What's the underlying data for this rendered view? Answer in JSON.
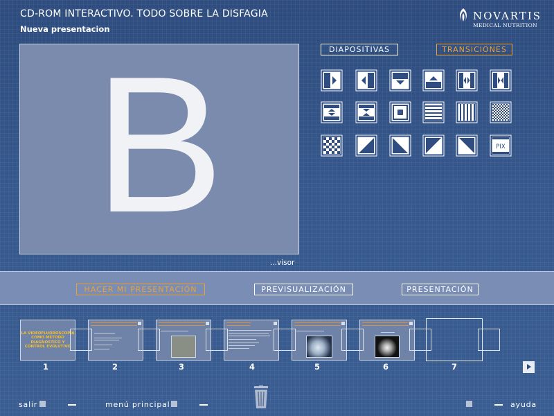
{
  "header": {
    "app_title": "CD-ROM INTERACTIVO. TODO SOBRE LA DISFAGIA",
    "subtitle": "Nueva presentacion",
    "logo": {
      "brand": "NOVARTIS",
      "sub": "MEDICAL NUTRITION"
    }
  },
  "preview": {
    "letter": "B",
    "label": "...visor"
  },
  "tabs": {
    "diapositivas": "DIAPOSITIVAS",
    "transiciones": "TRANSICIONES",
    "active": "transiciones"
  },
  "transitions": [
    "wipe-right-icon",
    "wipe-left-icon",
    "wipe-down-icon",
    "wipe-up-icon",
    "split-horizontal-out-icon",
    "split-horizontal-in-icon",
    "split-vertical-out-icon",
    "split-vertical-in-icon",
    "box-in-icon",
    "blinds-horizontal-icon",
    "blinds-vertical-icon",
    "dissolve-icon",
    "checkerboard-icon",
    "diagonal-bottom-right-icon",
    "diagonal-bottom-left-icon",
    "diagonal-top-left-icon",
    "diagonal-top-right-icon",
    "pix-icon"
  ],
  "pix_label": "PIX",
  "actions": {
    "hacer": "HACER MI PRESENTACIÓN",
    "previsualizacion": "PREVISUALIZACIÓN",
    "presentacion": "PRESENTACIÓN"
  },
  "slides": [
    {
      "number": "1",
      "title_text": "LA VIDEOFLUOROSCOPIA COMO METODO DIAGNOSTICO Y CONTROL EVOLUTIVO"
    },
    {
      "number": "2"
    },
    {
      "number": "3"
    },
    {
      "number": "4"
    },
    {
      "number": "5"
    },
    {
      "number": "6"
    },
    {
      "number": "7"
    }
  ],
  "footer": {
    "salir": "salir",
    "menu": "menú principal",
    "ayuda": "ayuda"
  },
  "colors": {
    "accent": "#f0a030",
    "background": "#2f4d80",
    "band": "#7a8eb5",
    "preview": "#7b8bad"
  }
}
